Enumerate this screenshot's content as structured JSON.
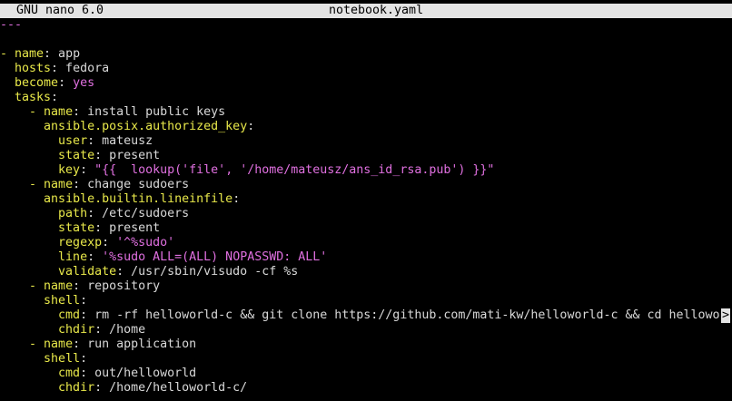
{
  "titlebar": {
    "version": "GNU nano 6.0",
    "filename": "notebook.yaml"
  },
  "colors": {
    "key": "#e8e84a",
    "value": "#d9d9d9",
    "string": "#e070e0",
    "dash": "#e8e84a",
    "docstart": "#e070e0",
    "bool": "#e070e0"
  },
  "lines": [
    {
      "indent": "",
      "parts": [
        {
          "t": "---",
          "c": "docstart"
        }
      ]
    },
    {
      "indent": "",
      "parts": []
    },
    {
      "indent": "",
      "parts": [
        {
          "t": "- ",
          "c": "dash"
        },
        {
          "t": "name",
          "c": "key"
        },
        {
          "t": ": app",
          "c": "value"
        }
      ]
    },
    {
      "indent": "  ",
      "parts": [
        {
          "t": "hosts",
          "c": "key"
        },
        {
          "t": ": fedora",
          "c": "value"
        }
      ]
    },
    {
      "indent": "  ",
      "parts": [
        {
          "t": "become",
          "c": "key"
        },
        {
          "t": ": ",
          "c": "value"
        },
        {
          "t": "yes",
          "c": "bool"
        }
      ]
    },
    {
      "indent": "  ",
      "parts": [
        {
          "t": "tasks",
          "c": "key"
        },
        {
          "t": ":",
          "c": "value"
        }
      ]
    },
    {
      "indent": "    ",
      "parts": [
        {
          "t": "- ",
          "c": "dash"
        },
        {
          "t": "name",
          "c": "key"
        },
        {
          "t": ": install public keys",
          "c": "value"
        }
      ]
    },
    {
      "indent": "      ",
      "parts": [
        {
          "t": "ansible.posix.authorized_key",
          "c": "key"
        },
        {
          "t": ":",
          "c": "value"
        }
      ]
    },
    {
      "indent": "        ",
      "parts": [
        {
          "t": "user",
          "c": "key"
        },
        {
          "t": ": mateusz",
          "c": "value"
        }
      ]
    },
    {
      "indent": "        ",
      "parts": [
        {
          "t": "state",
          "c": "key"
        },
        {
          "t": ": present",
          "c": "value"
        }
      ]
    },
    {
      "indent": "        ",
      "parts": [
        {
          "t": "key",
          "c": "key"
        },
        {
          "t": ": ",
          "c": "value"
        },
        {
          "t": "\"{{  lookup('file', '/home/mateusz/ans_id_rsa.pub') }}\"",
          "c": "string"
        }
      ]
    },
    {
      "indent": "    ",
      "parts": [
        {
          "t": "- ",
          "c": "dash"
        },
        {
          "t": "name",
          "c": "key"
        },
        {
          "t": ": change sudoers",
          "c": "value"
        }
      ]
    },
    {
      "indent": "      ",
      "parts": [
        {
          "t": "ansible.builtin.lineinfile",
          "c": "key"
        },
        {
          "t": ":",
          "c": "value"
        }
      ]
    },
    {
      "indent": "        ",
      "parts": [
        {
          "t": "path",
          "c": "key"
        },
        {
          "t": ": /etc/sudoers",
          "c": "value"
        }
      ]
    },
    {
      "indent": "        ",
      "parts": [
        {
          "t": "state",
          "c": "key"
        },
        {
          "t": ": present",
          "c": "value"
        }
      ]
    },
    {
      "indent": "        ",
      "parts": [
        {
          "t": "regexp",
          "c": "key"
        },
        {
          "t": ": ",
          "c": "value"
        },
        {
          "t": "'^%sudo'",
          "c": "string"
        }
      ]
    },
    {
      "indent": "        ",
      "parts": [
        {
          "t": "line",
          "c": "key"
        },
        {
          "t": ": ",
          "c": "value"
        },
        {
          "t": "'%sudo ALL=(ALL) NOPASSWD: ALL'",
          "c": "string"
        }
      ]
    },
    {
      "indent": "        ",
      "parts": [
        {
          "t": "validate",
          "c": "key"
        },
        {
          "t": ": /usr/sbin/visudo -cf %s",
          "c": "value"
        }
      ]
    },
    {
      "indent": "    ",
      "parts": [
        {
          "t": "- ",
          "c": "dash"
        },
        {
          "t": "name",
          "c": "key"
        },
        {
          "t": ": repository",
          "c": "value"
        }
      ]
    },
    {
      "indent": "      ",
      "parts": [
        {
          "t": "shell",
          "c": "key"
        },
        {
          "t": ":",
          "c": "value"
        }
      ]
    },
    {
      "indent": "        ",
      "parts": [
        {
          "t": "cmd",
          "c": "key"
        },
        {
          "t": ": rm -rf helloworld-c && git clone https://github.com/mati-kw/helloworld-c && cd hellowo",
          "c": "value"
        }
      ],
      "overflow": ">"
    },
    {
      "indent": "        ",
      "parts": [
        {
          "t": "chdir",
          "c": "key"
        },
        {
          "t": ": /home",
          "c": "value"
        }
      ]
    },
    {
      "indent": "    ",
      "parts": [
        {
          "t": "- ",
          "c": "dash"
        },
        {
          "t": "name",
          "c": "key"
        },
        {
          "t": ": run application",
          "c": "value"
        }
      ]
    },
    {
      "indent": "      ",
      "parts": [
        {
          "t": "shell",
          "c": "key"
        },
        {
          "t": ":",
          "c": "value"
        }
      ]
    },
    {
      "indent": "        ",
      "parts": [
        {
          "t": "cmd",
          "c": "key"
        },
        {
          "t": ": out/helloworld",
          "c": "value"
        }
      ]
    },
    {
      "indent": "        ",
      "parts": [
        {
          "t": "chdir",
          "c": "key"
        },
        {
          "t": ": /home/helloworld-c/",
          "c": "value"
        }
      ]
    }
  ]
}
